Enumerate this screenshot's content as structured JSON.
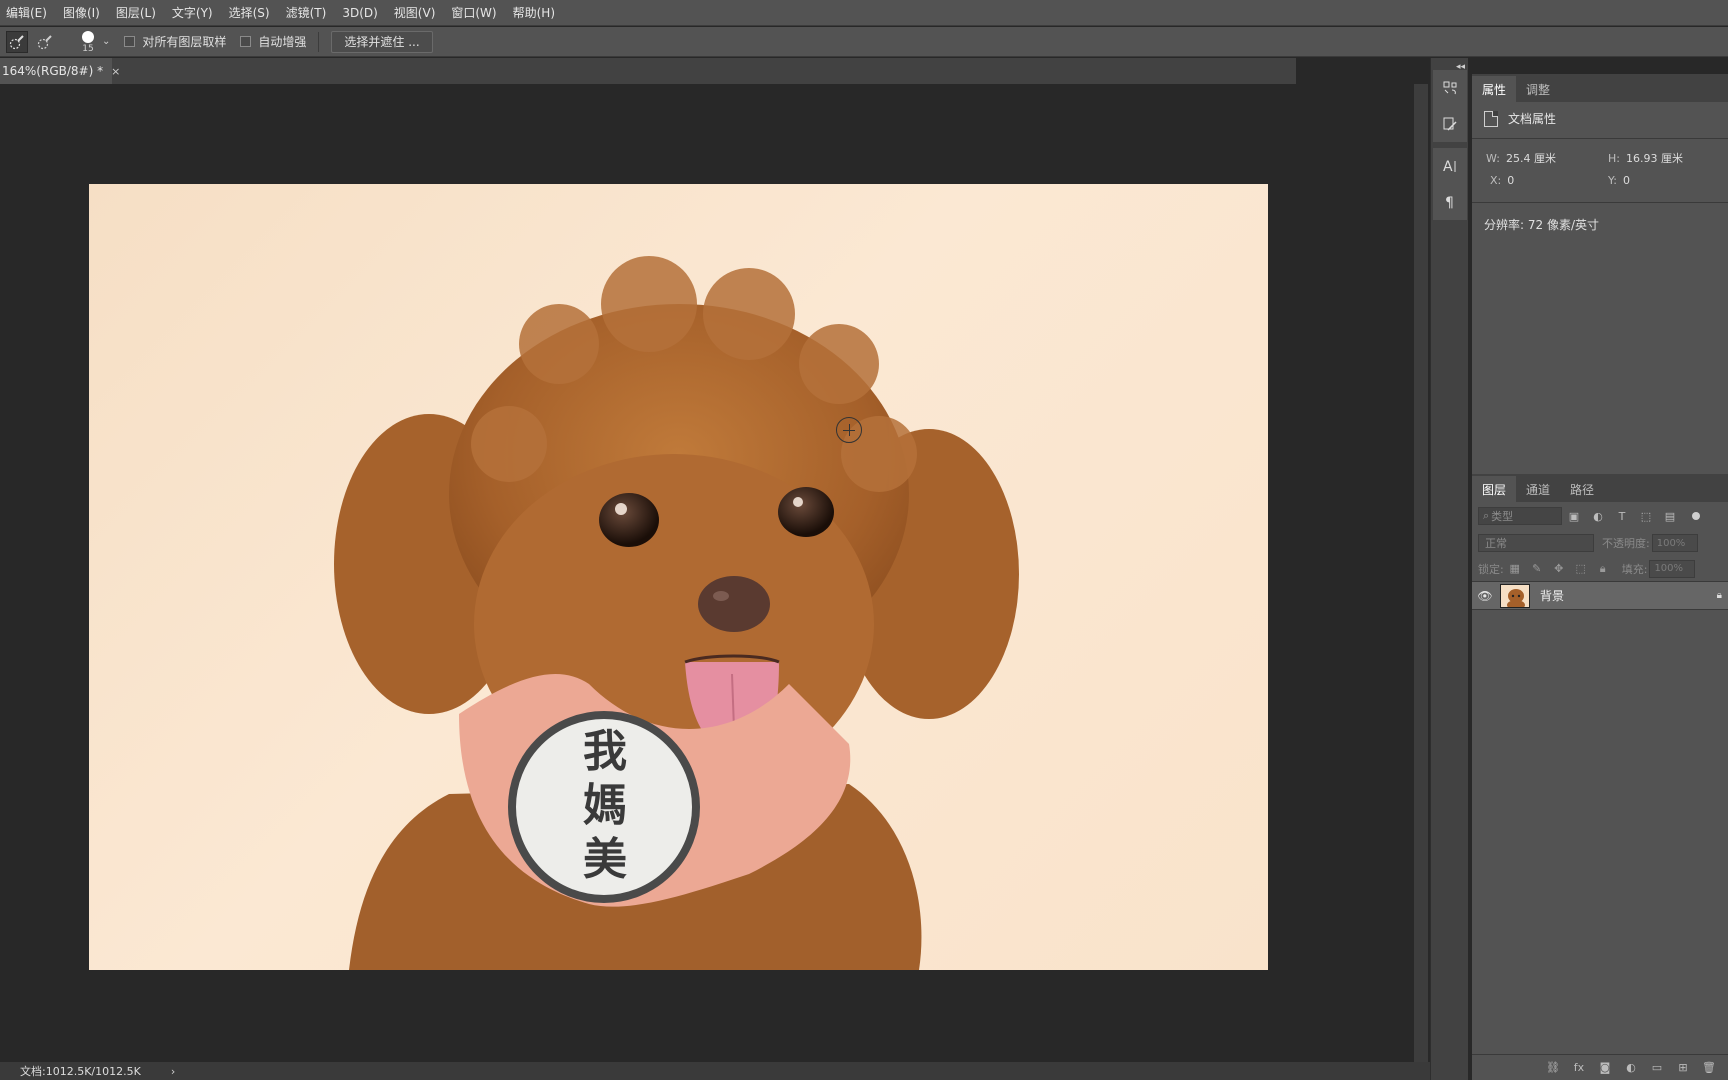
{
  "menu": [
    "编辑(E)",
    "图像(I)",
    "图层(L)",
    "文字(Y)",
    "选择(S)",
    "滤镜(T)",
    "3D(D)",
    "视图(V)",
    "窗口(W)",
    "帮助(H)"
  ],
  "options": {
    "brush_size": "15",
    "sample_all_layers": "对所有图层取样",
    "auto_enhance": "自动增强",
    "select_and_mask": "选择并遮住 ..."
  },
  "document": {
    "tab_title": "164%(RGB/8#) *",
    "close": "×"
  },
  "status": {
    "doc_info": "文档:1012.5K/1012.5K",
    "arrow": "›"
  },
  "properties": {
    "tabs": [
      "属性",
      "调整"
    ],
    "section_title": "文档属性",
    "w_label": "W:",
    "w_value": "25.4 厘米",
    "h_label": "H:",
    "h_value": "16.93 厘米",
    "x_label": "X:",
    "x_value": "0",
    "y_label": "Y:",
    "y_value": "0",
    "resolution": "分辨率: 72 像素/英寸"
  },
  "layers_panel": {
    "tabs": [
      "图层",
      "通道",
      "路径"
    ],
    "filter_placeholder": "类型",
    "blend_mode": "正常",
    "opacity_label": "不透明度:",
    "opacity_value": "100%",
    "lock_label": "锁定:",
    "fill_label": "填充:",
    "fill_value": "100%",
    "layers": [
      {
        "name": "背景"
      }
    ]
  },
  "photo": {
    "tag_chars": [
      "我",
      "媽",
      "美"
    ]
  }
}
